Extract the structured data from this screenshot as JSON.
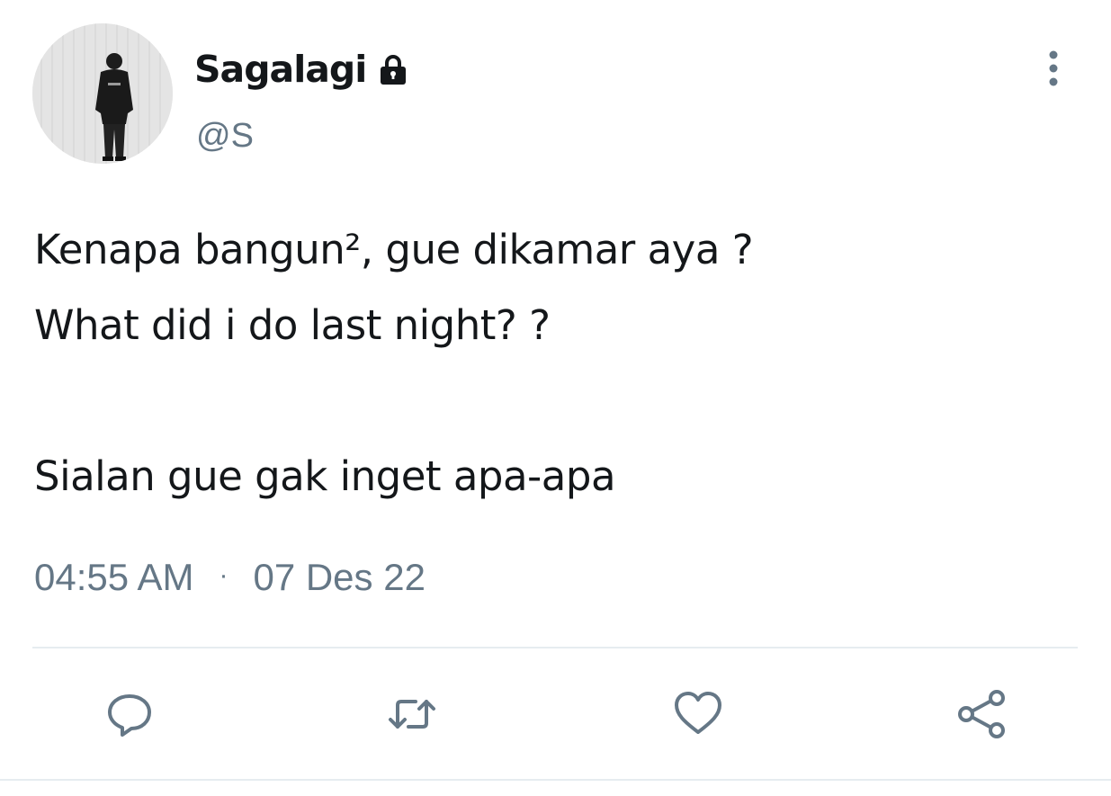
{
  "tweet": {
    "author": {
      "display_name": "Sagalagi",
      "handle": "@S",
      "verified_icon": "lock-icon",
      "avatar": "profile-photo"
    },
    "text_lines": [
      "Kenapa bangun², gue dikamar aya ?",
      "What did i do last night? ?",
      "",
      "Sialan gue gak inget apa-apa"
    ],
    "time": "04:55 AM",
    "separator": "·",
    "date": "07 Des 22",
    "menu_icon": "more-vertical-icon",
    "actions": [
      {
        "icon": "reply-icon"
      },
      {
        "icon": "retweet-icon"
      },
      {
        "icon": "like-icon"
      },
      {
        "icon": "share-icon"
      }
    ],
    "colors": {
      "text": "#14171a",
      "secondary": "#657786",
      "divider": "#e6ecf0"
    }
  }
}
